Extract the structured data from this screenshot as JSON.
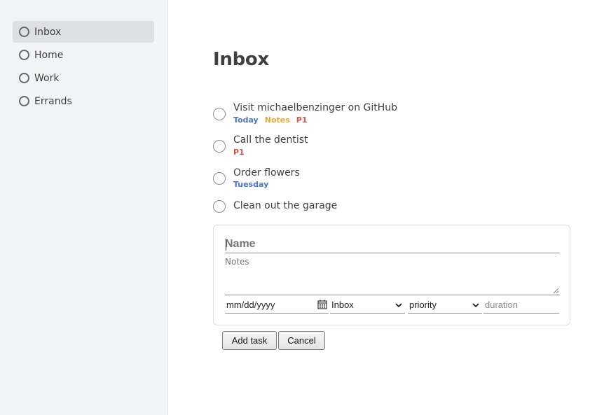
{
  "sidebar": {
    "items": [
      {
        "label": "Inbox"
      },
      {
        "label": "Home"
      },
      {
        "label": "Work"
      },
      {
        "label": "Errands"
      }
    ]
  },
  "main": {
    "title": "Inbox",
    "tasks": [
      {
        "name": "Visit michaelbenzinger on GitHub",
        "tags": [
          {
            "text": "Today",
            "color": "#4a77c8"
          },
          {
            "text": "Notes",
            "color": "#e5a935"
          },
          {
            "text": "P1",
            "color": "#d9534f"
          }
        ]
      },
      {
        "name": "Call the dentist",
        "tags": [
          {
            "text": "P1",
            "color": "#d9534f"
          }
        ]
      },
      {
        "name": "Order flowers",
        "tags": [
          {
            "text": "Tuesday",
            "color": "#4a77c8"
          }
        ]
      },
      {
        "name": "Clean out the garage",
        "tags": []
      }
    ]
  },
  "form": {
    "name_placeholder": "Name",
    "notes_placeholder": "Notes",
    "date_placeholder": "mm/dd/yyyy",
    "project_value": "Inbox",
    "priority_value": "priority",
    "duration_placeholder": "duration",
    "add_label": "Add task",
    "cancel_label": "Cancel"
  }
}
